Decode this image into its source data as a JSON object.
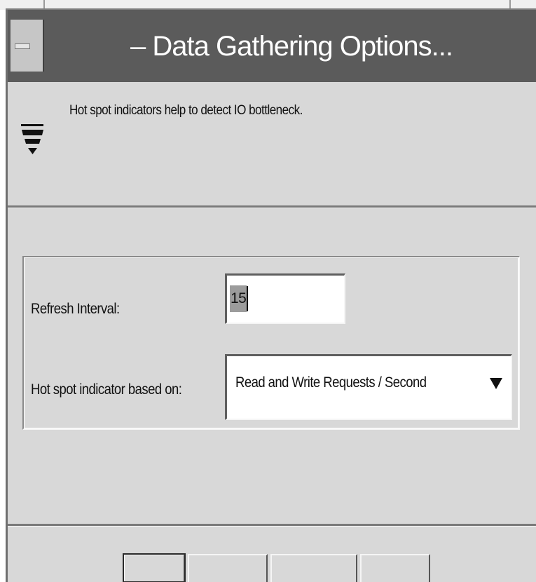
{
  "window": {
    "title": "– Data Gathering Options..."
  },
  "info": {
    "message": "Hot spot indicators help to detect IO bottleneck.",
    "icon": "hotspot-icon"
  },
  "form": {
    "refresh_interval": {
      "label": "Refresh Interval:",
      "value": "15"
    },
    "hot_spot_indicator": {
      "label": "Hot spot indicator based on:",
      "selected": "Read and Write Requests / Second",
      "icon": "dropdown-arrow-icon"
    }
  },
  "colors": {
    "titlebar": "#5b5b5b",
    "background": "#d8d8d8",
    "title_text": "#ffffff"
  }
}
